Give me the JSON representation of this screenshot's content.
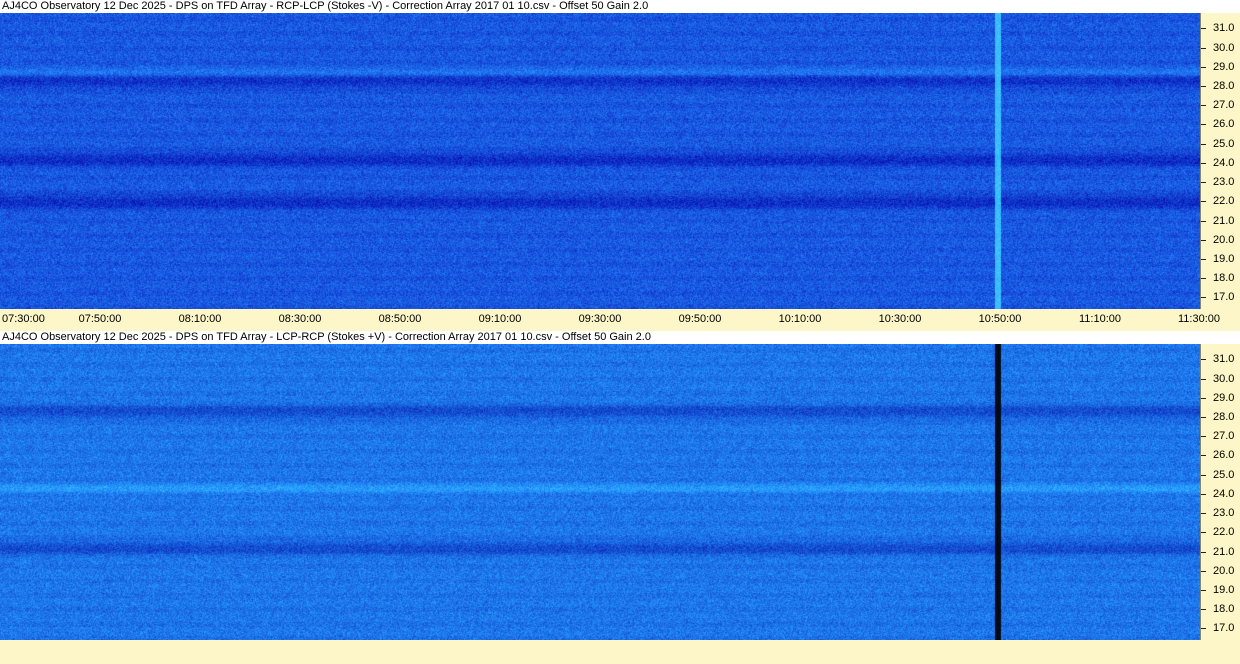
{
  "chart_data": [
    {
      "type": "heatmap",
      "title": "AJ4CO Observatory 12 Dec 2025  -  DPS on TFD Array  -  RCP-LCP (Stokes -V)  -  Correction Array 2017 01 10.csv  -  Offset 50  Gain 2.0",
      "x_ticks": [
        "07:30:00",
        "07:50:00",
        "08:10:00",
        "08:30:00",
        "08:50:00",
        "09:10:00",
        "09:30:00",
        "09:50:00",
        "10:10:00",
        "10:30:00",
        "10:50:00",
        "11:10:00",
        "11:30:00"
      ],
      "y_ticks": [
        "31.0",
        "30.0",
        "29.0",
        "28.0",
        "27.0",
        "26.0",
        "25.0",
        "24.0",
        "23.0",
        "22.0",
        "21.0",
        "20.0",
        "19.0",
        "18.0",
        "17.0"
      ],
      "ylim": [
        16.4,
        31.8
      ],
      "colormap": "blue",
      "features": {
        "dark_bands_mhz": [
          24.2,
          28.3,
          22.0
        ],
        "bright_bands_mhz": [
          28.7
        ],
        "vertical_line_time": "10:49:30",
        "vertical_line_style": "bright"
      }
    },
    {
      "type": "heatmap",
      "title": "AJ4CO Observatory 12 Dec 2025  -  DPS on TFD Array  -  LCP-RCP (Stokes +V)  -  Correction Array 2017 01 10.csv  -  Offset 50  Gain 2.0",
      "x_ticks": [],
      "y_ticks": [
        "31.0",
        "30.0",
        "29.0",
        "28.0",
        "27.0",
        "26.0",
        "25.0",
        "24.0",
        "23.0",
        "22.0",
        "21.0",
        "20.0",
        "19.0",
        "18.0",
        "17.0"
      ],
      "ylim": [
        16.4,
        31.8
      ],
      "colormap": "blue",
      "features": {
        "dark_bands_mhz": [
          28.3,
          21.2
        ],
        "bright_bands_mhz": [
          24.3
        ],
        "vertical_line_time": "10:49:30",
        "vertical_line_style": "dark"
      }
    }
  ]
}
